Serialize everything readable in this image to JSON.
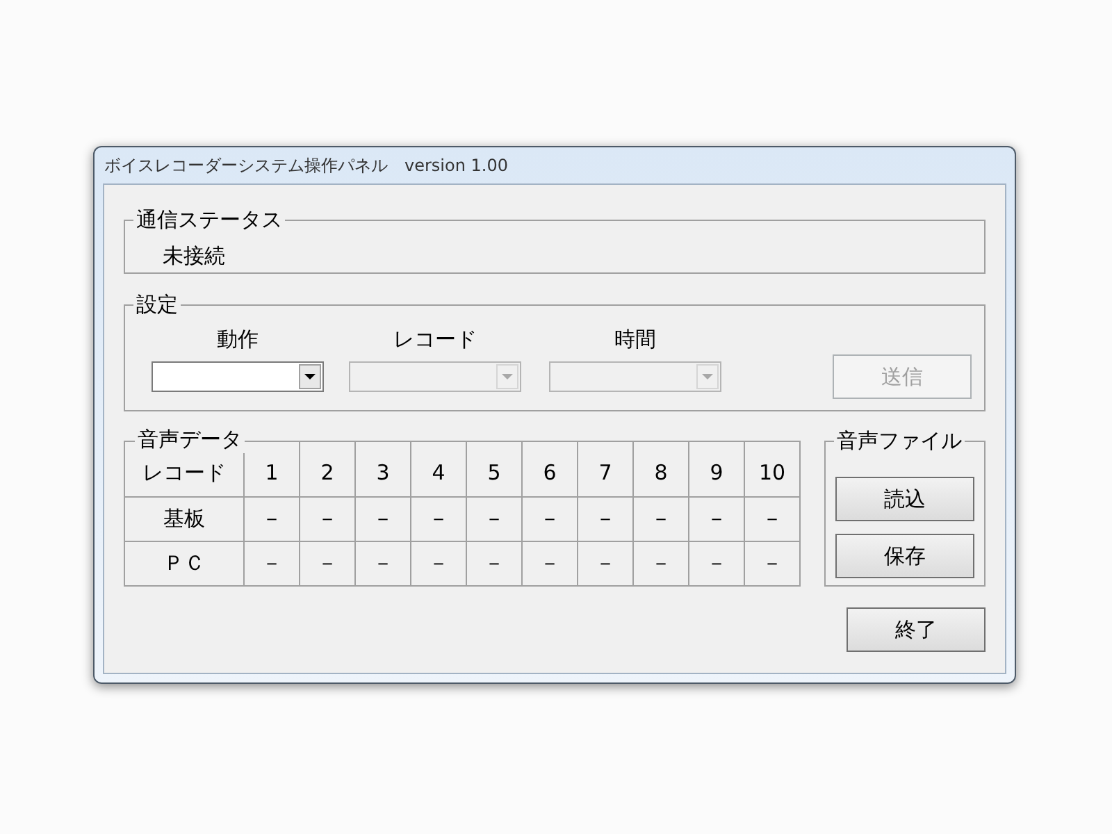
{
  "window": {
    "title": "ボイスレコーダーシステム操作パネル　version 1.00"
  },
  "status_group": {
    "label": "通信ステータス",
    "value": "未接続"
  },
  "settings_group": {
    "label": "設定",
    "fields": [
      {
        "label": "動作",
        "disabled": false
      },
      {
        "label": "レコード",
        "disabled": true
      },
      {
        "label": "時間",
        "disabled": true
      }
    ],
    "send_button": {
      "label": "送信",
      "disabled": true
    }
  },
  "voice_data": {
    "label": "音声データ",
    "columns": [
      "レコード",
      "1",
      "2",
      "3",
      "4",
      "5",
      "6",
      "7",
      "8",
      "9",
      "10"
    ],
    "rows": [
      [
        "基板",
        "－",
        "－",
        "－",
        "－",
        "－",
        "－",
        "－",
        "－",
        "－",
        "－"
      ],
      [
        "ＰＣ",
        "－",
        "－",
        "－",
        "－",
        "－",
        "－",
        "－",
        "－",
        "－",
        "－"
      ]
    ]
  },
  "voice_file": {
    "label": "音声ファイル",
    "buttons": [
      {
        "label": "読込",
        "disabled": false
      },
      {
        "label": "保存",
        "disabled": false
      }
    ]
  },
  "exit_button": {
    "label": "終了",
    "disabled": false
  }
}
